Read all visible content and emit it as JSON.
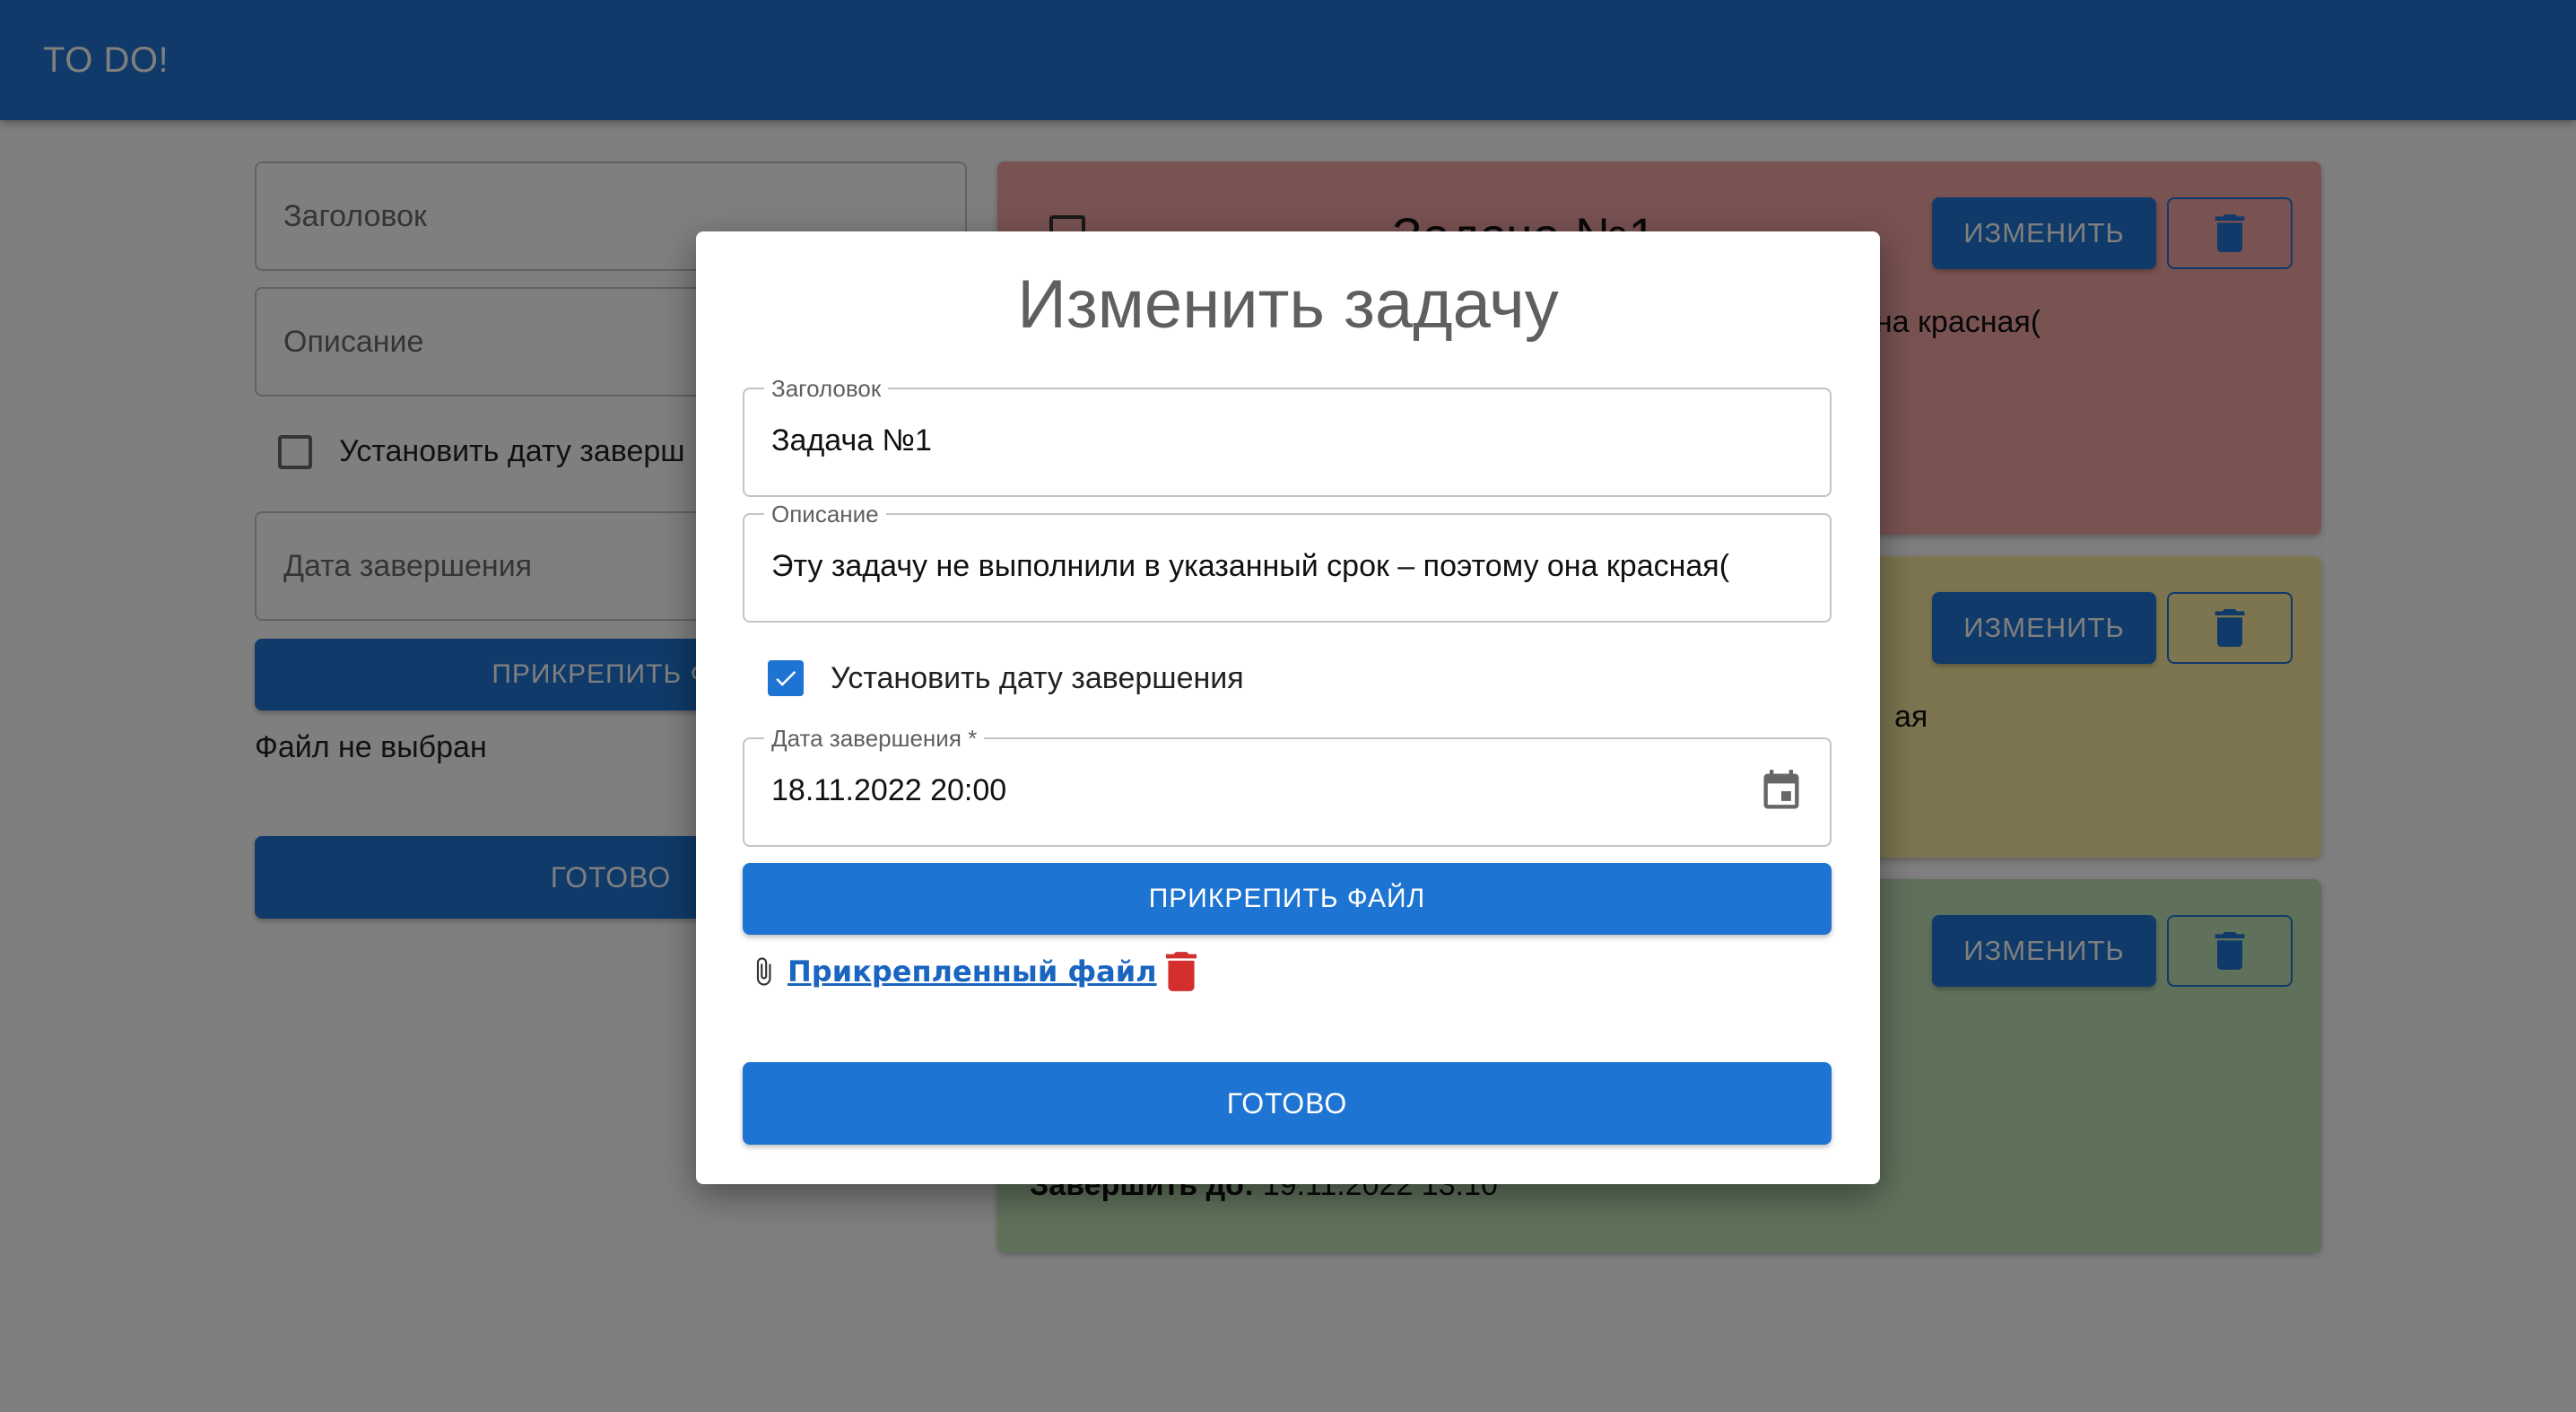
{
  "app": {
    "title": "TO DO!"
  },
  "colors": {
    "primary": "#1e74d2",
    "danger": "#d32f2f",
    "card_red": "#f3a4a4",
    "card_yellow": "#f8eba0",
    "card_green": "#bfe3b7"
  },
  "left_form": {
    "title_placeholder": "Заголовок",
    "description_placeholder": "Описание",
    "set_deadline_label": "Установить дату заверш",
    "deadline_placeholder": "Дата завершения",
    "attach_button": "ПРИКРЕПИТЬ ФА",
    "file_status": "Файл не выбран",
    "done_button": "ГОТОВО"
  },
  "tasks": [
    {
      "title": "Задача №1",
      "description": "она красная(",
      "edit_button": "ИЗМЕНИТЬ",
      "delete_icon": "trash-icon"
    },
    {
      "description": "ая",
      "edit_button": "ИЗМЕНИТЬ",
      "delete_icon": "trash-icon"
    },
    {
      "deadline_label": "Завершить до:",
      "deadline_value": "19.11.2022 13:10",
      "edit_button": "ИЗМЕНИТЬ",
      "delete_icon": "trash-icon"
    }
  ],
  "modal": {
    "title": "Изменить задачу",
    "title_field": {
      "label": "Заголовок",
      "value": "Задача №1"
    },
    "description_field": {
      "label": "Описание",
      "value": "Эту задачу не выполнили в указанный срок – поэтому она красная("
    },
    "set_deadline": {
      "label": "Установить дату завершения",
      "checked": true
    },
    "deadline_field": {
      "label": "Дата завершения *",
      "value": "18.11.2022 20:00",
      "icon": "calendar-icon"
    },
    "attach_button": "ПРИКРЕПИТЬ ФАЙЛ",
    "attached_file": {
      "link_text": "Прикрепленный файл",
      "icon": "paperclip-icon",
      "delete_icon": "trash-icon"
    },
    "done_button": "ГОТОВО"
  }
}
